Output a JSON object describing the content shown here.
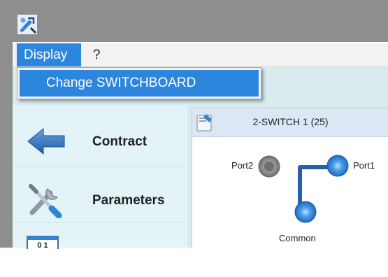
{
  "app": {
    "icon": "app-logo-icon"
  },
  "menubar": {
    "items": [
      {
        "label": "Display",
        "active": true
      },
      {
        "label": "?"
      }
    ]
  },
  "dropdown": {
    "items": [
      {
        "label": "Change SWITCHBOARD",
        "highlighted": true
      }
    ]
  },
  "sidebar": {
    "items": [
      {
        "label": "Contract",
        "icon": "arrow-left-icon"
      },
      {
        "label": "Parameters",
        "icon": "tools-icon"
      },
      {
        "label": "",
        "icon": "calendar-icon",
        "icon_text": "0 1"
      }
    ]
  },
  "panel": {
    "title": "2-SWITCH 1 (25)",
    "icon": "panel-settings-icon",
    "ports": [
      {
        "label": "Port2",
        "state": "inactive",
        "color": "#8a8a8a"
      },
      {
        "label": "Port1",
        "state": "active",
        "color": "#2f86de"
      },
      {
        "label": "Common",
        "state": "active",
        "color": "#2f86de"
      }
    ]
  },
  "colors": {
    "titlebar": "#8e8e8e",
    "menu_highlight": "#2d86de",
    "sidebar_bg": "#e4f3f7",
    "panel_header": "#dbe7f5",
    "connection": "#2a5fa8"
  }
}
